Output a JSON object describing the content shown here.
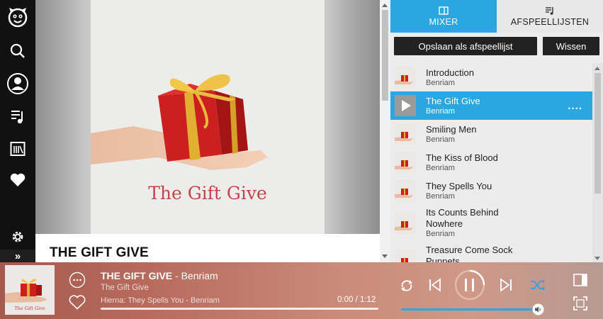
{
  "nav": {
    "items": [
      {
        "name": "logo-icon"
      },
      {
        "name": "search-icon"
      },
      {
        "name": "profile-icon"
      },
      {
        "name": "music-library-icon"
      },
      {
        "name": "radio-icon"
      },
      {
        "name": "heart-icon"
      },
      {
        "name": "gear-icon"
      },
      {
        "name": "expand-icon",
        "glyph": "»"
      }
    ]
  },
  "album": {
    "cover_caption": "The Gift Give",
    "title": "THE GIFT GIVE"
  },
  "panel": {
    "tabs": [
      {
        "label": "MIXER",
        "icon": "panel-icon",
        "active": true
      },
      {
        "label": "AFSPEELLIJSTEN",
        "icon": "playlist-icon",
        "active": false
      }
    ],
    "save_label": "Opslaan als afspeellijst",
    "clear_label": "Wissen",
    "active_more": "....",
    "queue": [
      {
        "title": "Introduction",
        "artist": "Benriam",
        "active": false
      },
      {
        "title": "The Gift Give",
        "artist": "Benriam",
        "active": true
      },
      {
        "title": "Smiling Men",
        "artist": "Benriam",
        "active": false
      },
      {
        "title": "The Kiss of Blood",
        "artist": "Benriam",
        "active": false
      },
      {
        "title": "They Spells You",
        "artist": "Benriam",
        "active": false
      },
      {
        "title": "Its Counts Behind Nowhere",
        "artist": "Benriam",
        "active": false
      },
      {
        "title": "Treasure Come Sock Puppets",
        "artist": "",
        "active": false
      }
    ]
  },
  "player": {
    "track_title": "THE GIFT GIVE",
    "artist_suffix": " - Benriam",
    "album": "The Gift Give",
    "up_next": "Hierna: They Spells You - Benriam",
    "time": "0:00 / 1:12",
    "progress": 0.0,
    "volume": 1.0,
    "thumb_caption": "The Gift Give",
    "colors": {
      "accent": "#2ca6e0",
      "bar_left": "#a45a4e",
      "bar_right": "#b79a93"
    }
  }
}
